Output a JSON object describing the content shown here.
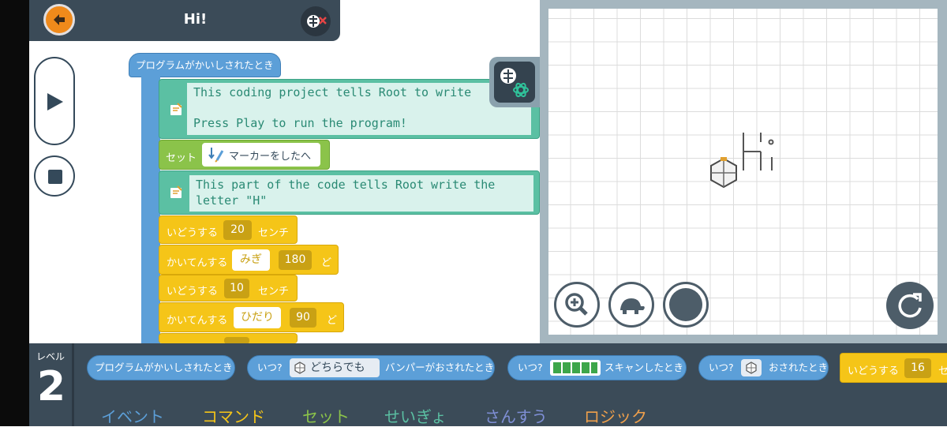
{
  "title": "Hi!",
  "blocks": {
    "start_event": "プログラムがかいしされたとき",
    "comment1_line1": "This coding project tells Root to write",
    "comment1_line2": "Press Play to run the program!",
    "set_label": "セット",
    "set_value": "マーカーをしたへ",
    "comment2_line1": "This part of the code tells Root write the",
    "comment2_line2": "letter \"H\"",
    "move1_label": "いどうする",
    "move1_value": "20",
    "move1_unit": "センチ",
    "rotate1_label": "かいてんする",
    "rotate1_dir": "みぎ",
    "rotate1_value": "180",
    "rotate1_unit": "ど",
    "move2_label": "いどうする",
    "move2_value": "10",
    "move2_unit": "センチ",
    "rotate2_label": "かいてんする",
    "rotate2_dir": "ひだり",
    "rotate2_value": "90",
    "rotate2_unit": "ど"
  },
  "level": {
    "label": "レベル",
    "number": "2"
  },
  "palette": {
    "start_event": "プログラムがかいしされたとき",
    "when": "いつ?",
    "bumper_choice": "どちらでも",
    "bumper_event": "バンパーがおされたとき",
    "scan_event": "スキャンしたとき",
    "pressed_event": "おされたとき",
    "move_label": "いどうする",
    "move_value": "16",
    "move_unit_partial": "セ"
  },
  "categories": [
    "イベント",
    "コマンド",
    "セット",
    "せいぎょ",
    "さんすう",
    "ロジック"
  ],
  "colors": {
    "event": "#5c9fd8",
    "command": "#f5c518",
    "set": "#8bc34a",
    "control": "#5bc0a3",
    "math": "#7f8fd6",
    "logic": "#f0a04b",
    "back_button": "#f08a1b",
    "title_bar": "#3b4b58"
  },
  "icons": {
    "back": "arrow-left-icon",
    "robot_toggle": "robot-disconnect-icon",
    "play": "play-icon",
    "stop": "stop-icon",
    "robot_connect": "robot-bluetooth-icon",
    "zoom": "zoom-in-icon",
    "speed": "turtle-icon",
    "marker": "pen-dot-icon",
    "reset": "reset-icon",
    "comment": "note-icon",
    "marker_down": "marker-down-icon"
  }
}
